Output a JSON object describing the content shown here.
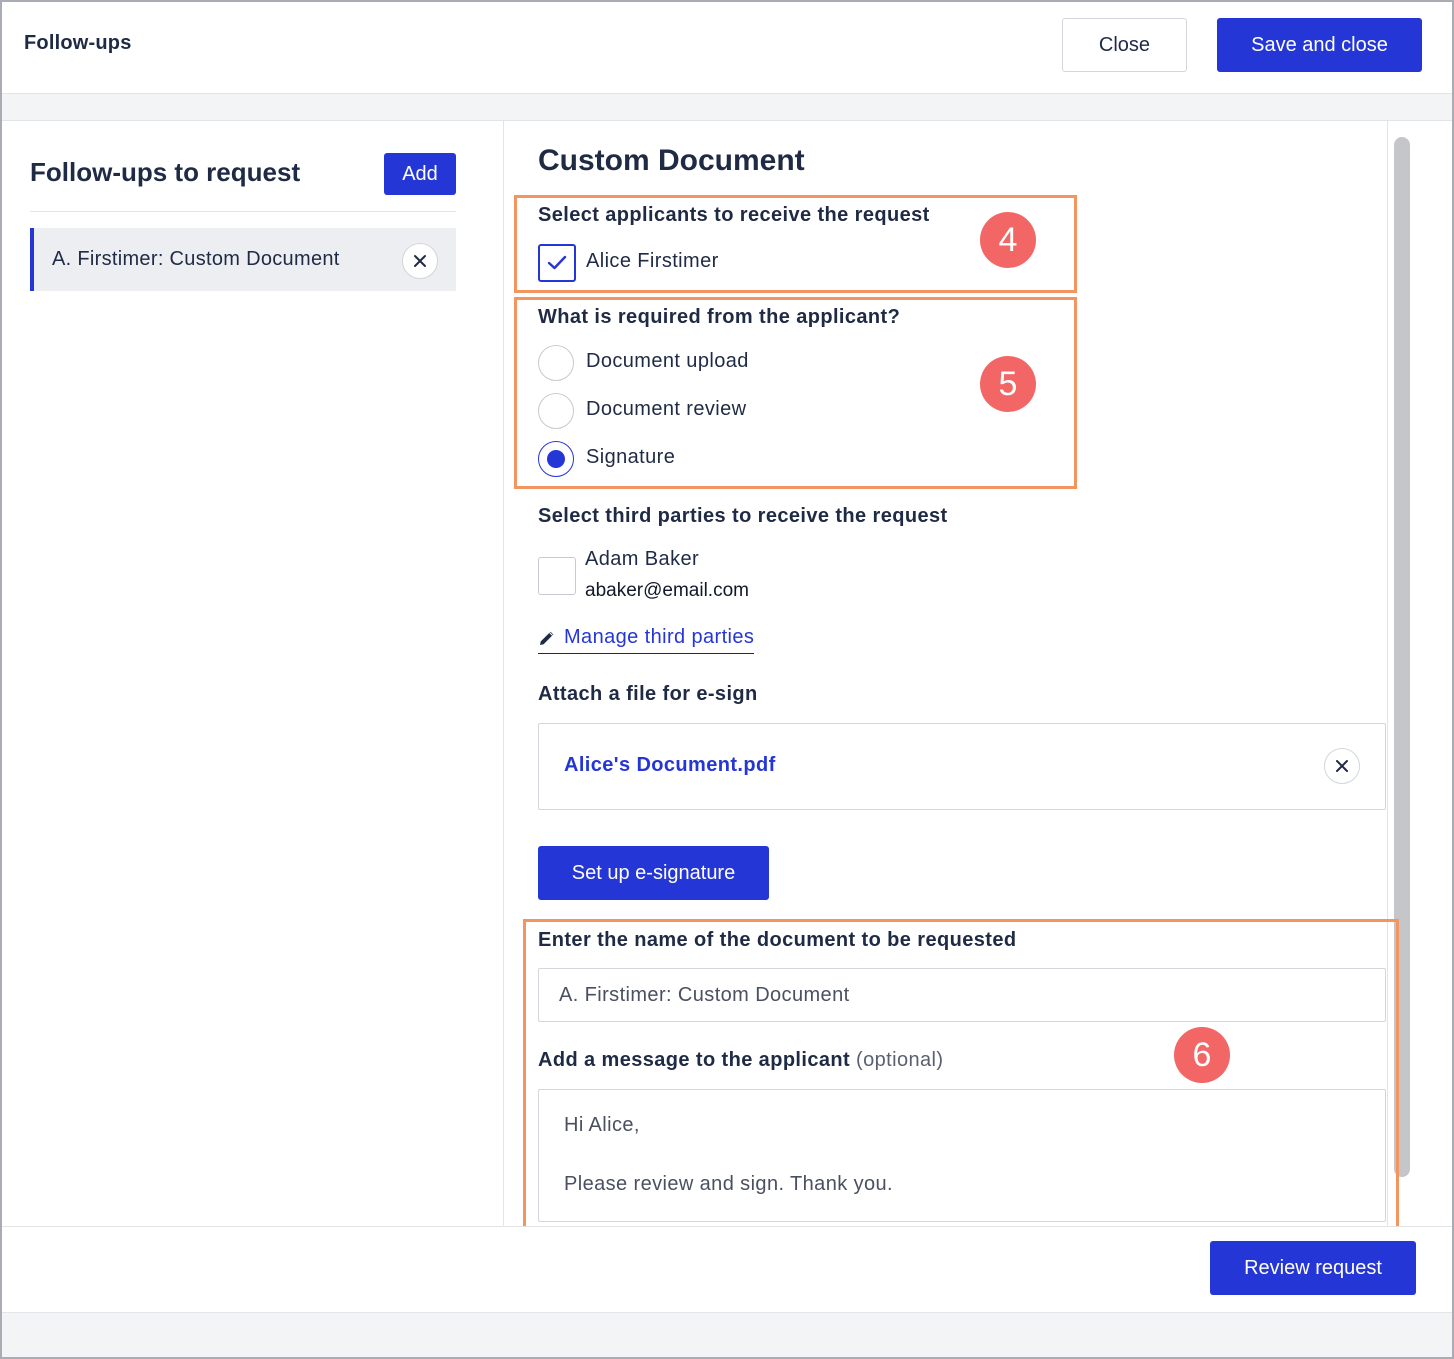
{
  "header": {
    "title": "Follow-ups",
    "close_label": "Close",
    "save_label": "Save and close"
  },
  "sidebar": {
    "title": "Follow-ups to request",
    "add_label": "Add",
    "items": [
      {
        "label": "A. Firstimer: Custom Document",
        "selected": true
      }
    ]
  },
  "main": {
    "title": "Custom Document",
    "applicants": {
      "label": "Select applicants to receive the request",
      "options": [
        {
          "name": "Alice Firstimer",
          "checked": true
        }
      ]
    },
    "requirement": {
      "label": "What is required from the applicant?",
      "options": [
        {
          "label": "Document upload",
          "selected": false
        },
        {
          "label": "Document review",
          "selected": false
        },
        {
          "label": "Signature",
          "selected": true
        }
      ]
    },
    "third_parties": {
      "label": "Select third parties to receive the request",
      "options": [
        {
          "name": "Adam Baker",
          "email": "abaker@email.com",
          "checked": false
        }
      ],
      "manage_label": "Manage third parties"
    },
    "attachment": {
      "label": "Attach a file for e-sign",
      "file_name": "Alice's Document.pdf",
      "setup_label": "Set up e-signature"
    },
    "document_name": {
      "label": "Enter the name of the document to be requested",
      "value": "A. Firstimer: Custom Document"
    },
    "message": {
      "label": "Add a message to the applicant",
      "optional": "(optional)",
      "line1": "Hi Alice,",
      "line2": "Please review and sign. Thank you."
    }
  },
  "footer": {
    "review_label": "Review request"
  },
  "annotations": [
    {
      "number": "4"
    },
    {
      "number": "5"
    },
    {
      "number": "6"
    }
  ],
  "colors": {
    "primary": "#2536d6",
    "annotation_border": "#f2955e",
    "annotation_badge": "#f26666",
    "text": "#1f2a44"
  }
}
